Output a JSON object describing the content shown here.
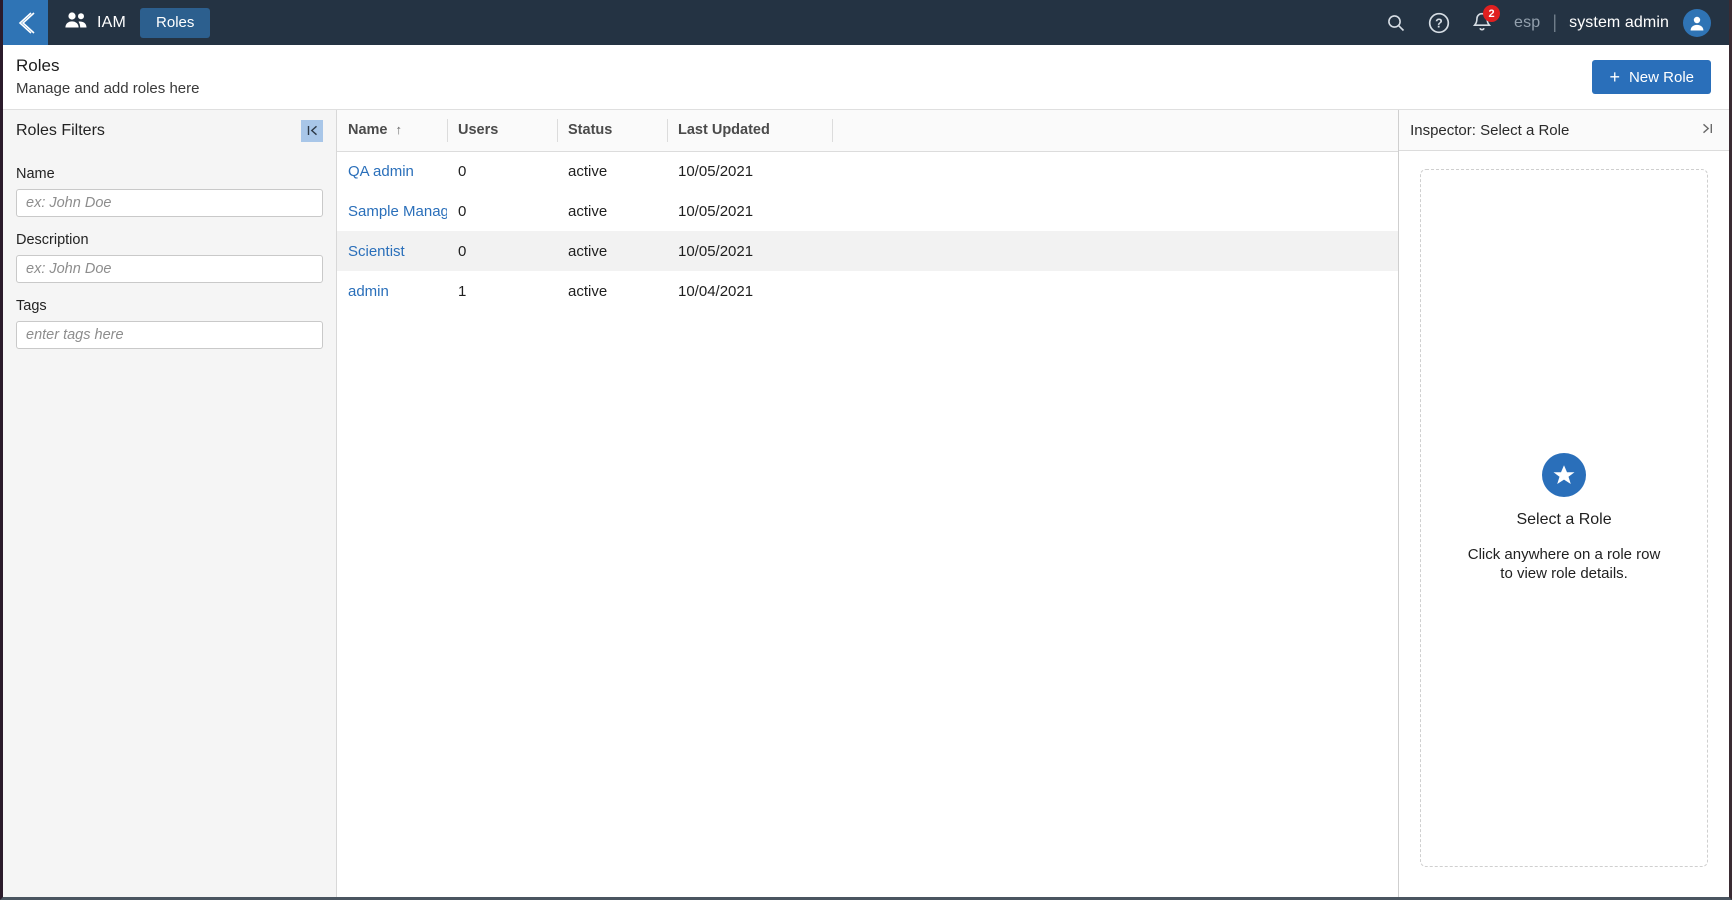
{
  "topbar": {
    "back_icon": "chevron-left-icon",
    "brand_icon": "people-icon",
    "brand_label": "IAM",
    "tabs": [
      {
        "label": "Roles",
        "active": true
      }
    ],
    "search_icon": "search-icon",
    "help_icon": "help-circle-icon",
    "bell_icon": "bell-icon",
    "bell_badge": "2",
    "tenant_label": "esp",
    "separator": "|",
    "user_name": "system admin",
    "avatar_icon": "user-avatar-icon"
  },
  "pagehead": {
    "title": "Roles",
    "subtitle": "Manage and add roles here",
    "new_button_label": "New Role",
    "new_button_plus": "+"
  },
  "filters": {
    "title": "Roles Filters",
    "collapse_icon": "collapse-left-icon",
    "collapse_glyph": "|‹",
    "fields": [
      {
        "label": "Name",
        "value": "",
        "placeholder": "ex: John Doe"
      },
      {
        "label": "Description",
        "value": "",
        "placeholder": "ex: John Doe"
      },
      {
        "label": "Tags",
        "value": "",
        "placeholder": "enter tags here"
      }
    ]
  },
  "table": {
    "columns": [
      {
        "label": "Name",
        "sorted": "asc",
        "sort_glyph": "↑"
      },
      {
        "label": "Users"
      },
      {
        "label": "Status"
      },
      {
        "label": "Last Updated"
      }
    ],
    "rows": [
      {
        "name": "QA admin",
        "users": "0",
        "status": "active",
        "updated": "10/05/2021",
        "selected": false
      },
      {
        "name": "Sample Manager",
        "users": "0",
        "status": "active",
        "updated": "10/05/2021",
        "selected": false
      },
      {
        "name": "Scientist",
        "users": "0",
        "status": "active",
        "updated": "10/05/2021",
        "selected": true
      },
      {
        "name": "admin",
        "users": "1",
        "status": "active",
        "updated": "10/04/2021",
        "selected": false
      }
    ]
  },
  "inspector": {
    "title": "Inspector: Select a Role",
    "expand_icon": "expand-right-icon",
    "expand_glyph": "›|",
    "empty_icon": "star-icon",
    "empty_title": "Select a Role",
    "empty_desc": "Click anywhere on a role row to view role details."
  },
  "colors": {
    "topbar_bg": "#243343",
    "accent_blue": "#2a6fba",
    "back_btn_blue": "#2f74b5",
    "tab_active_blue": "#2c5f8e",
    "badge_red": "#e02020",
    "filter_bg": "#f5f5f5",
    "row_selected": "#f2f2f2",
    "link_blue": "#2a6fba"
  }
}
